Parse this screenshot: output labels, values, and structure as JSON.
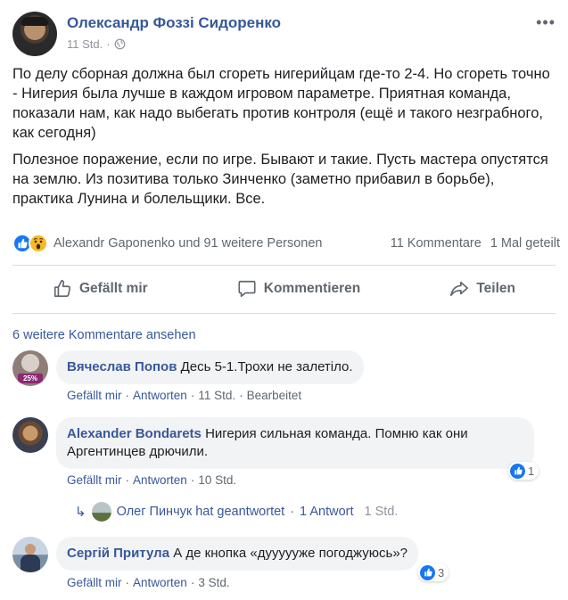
{
  "post": {
    "author": "Олександр Фоззі Сидоренко",
    "time": "11 Std.",
    "more_icon": "more-horizontal-icon",
    "paragraphs": [
      "По делу сборная должна был сгореть нигерийцам где-то 2-4. Но сгореть точно - Нигерия была лучше в каждом игровом параметре. Приятная команда, показали нам, как надо выбегать против контроля (ещё и такого незграбного, как сегодня)",
      "Полезное поражение, если по игре. Бывают и такие. Пусть мастера опустятся на землю. Из позитива только Зинченко (заметно прибавил в борьбе), практика Лунина и болельщики. Все."
    ]
  },
  "reactions": {
    "icons": [
      "like-icon",
      "wow-icon"
    ],
    "reactors": "Alexandr Gaponenko und 91 weitere Personen",
    "comments": "11 Kommentare",
    "shares": "1 Mal geteilt"
  },
  "actions": {
    "like": "Gefällt mir",
    "comment": "Kommentieren",
    "share": "Teilen"
  },
  "more_comments": "6 weitere Kommentare ansehen",
  "comments": [
    {
      "name": "Вячеслав Попов",
      "text": "Десь 5-1.Трохи не залетіло.",
      "avatar_badge": "25%",
      "like": "Gefällt mir",
      "reply": "Antworten",
      "time": "11 Std.",
      "edited": "Bearbeitet"
    },
    {
      "name": "Alexander Bondarets",
      "text_line1": "Нигерия сильная команда. Помню как они",
      "text_line2": "Аргентинцев дрючили.",
      "like": "Gefällt mir",
      "reply": "Antworten",
      "time": "10 Std.",
      "reaction_count": "1"
    },
    {
      "name": "Сергій Притула",
      "text": "А де кнопка «дуууууже погоджуюсь»?",
      "like": "Gefällt mir",
      "reply": "Antworten",
      "time": "3 Std.",
      "reaction_count": "3"
    }
  ],
  "reply_thread": {
    "name": "Олег Пинчук hat geantwortet",
    "sep": "·",
    "count": "1 Antwort",
    "time": "1 Std."
  },
  "colors": {
    "link": "#385898",
    "author": "#365899",
    "meta": "#90949c",
    "like_blue": "#1877f2",
    "bubble": "#f2f3f5"
  }
}
